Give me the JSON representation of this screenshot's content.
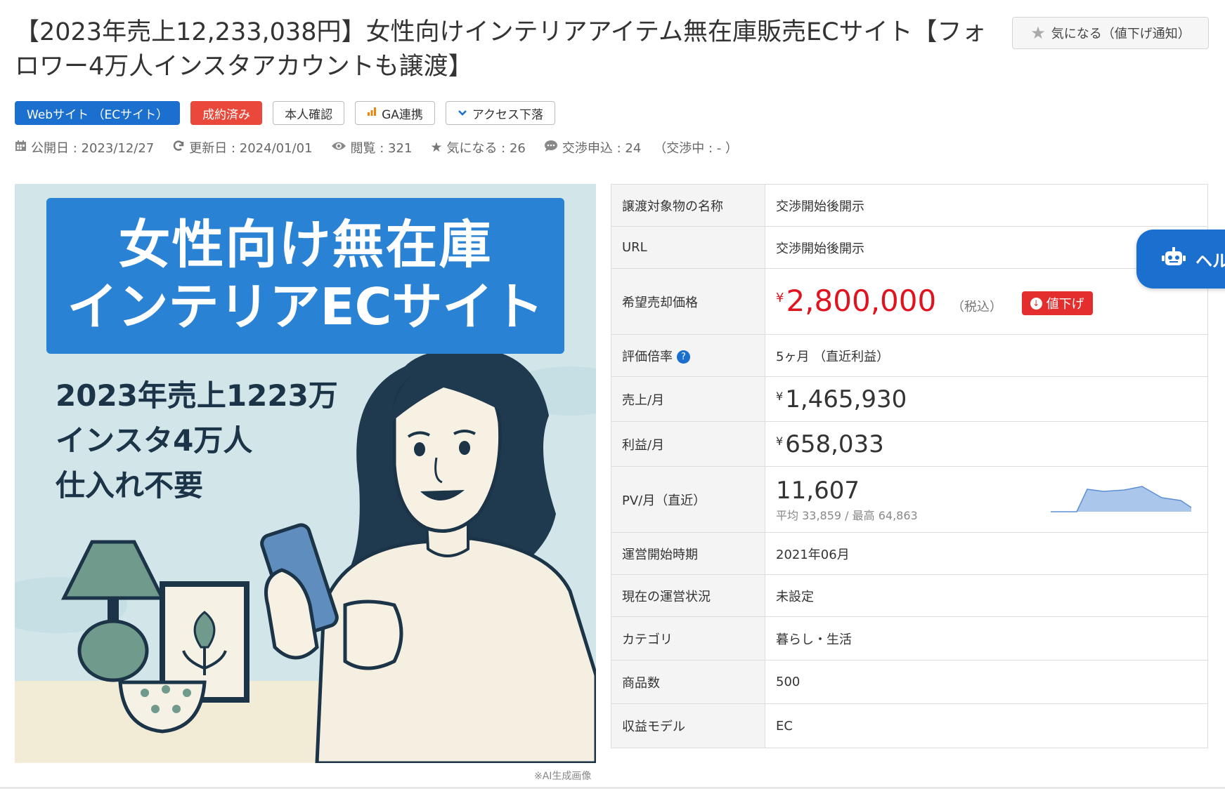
{
  "title": "【2023年売上12,233,038円】女性向けインテリアアイテム無在庫販売ECサイト【フォロワー4万人インスタアカウントも譲渡】",
  "favorite_button": {
    "label": "気になる（値下げ通知）",
    "icon": "star-icon"
  },
  "tags": [
    {
      "label": "Webサイト （ECサイト）",
      "style": "blue"
    },
    {
      "label": "成約済み",
      "style": "red"
    },
    {
      "label": "本人確認",
      "style": "outline"
    },
    {
      "label": "GA連携",
      "style": "outline",
      "icon": "bar-chart-icon"
    },
    {
      "label": "アクセス下落",
      "style": "outline",
      "icon": "chevron-down-icon"
    }
  ],
  "meta": {
    "published": "公開日 : 2023/12/27",
    "updated": "更新日 : 2024/01/01",
    "views": "閲覧 : 321",
    "favorites": "気になる : 26",
    "negotiations": "交渉申込 : 24",
    "in_negotiation": "（交渉中 : - ）"
  },
  "hero": {
    "banner_line1": "女性向け無在庫",
    "banner_line2": "インテリアECサイト",
    "sub_line1": "2023年売上1223万",
    "sub_line2": "インスタ4万人",
    "sub_line3": "仕入れ不要",
    "ai_note": "※AI生成画像"
  },
  "spec": {
    "name_label": "譲渡対象物の名称",
    "name_value": "交渉開始後開示",
    "url_label": "URL",
    "url_value": "交渉開始後開示",
    "price_label": "希望売却価格",
    "price_currency": "¥",
    "price_value": "2,800,000",
    "price_tax": "（税込）",
    "price_badge": "値下げ",
    "multiple_label": "評価倍率",
    "multiple_help": "?",
    "multiple_value": "5ヶ月 （直近利益）",
    "sales_label": "売上/月",
    "sales_currency": "¥",
    "sales_value": "1,465,930",
    "profit_label": "利益/月",
    "profit_currency": "¥",
    "profit_value": "658,033",
    "pv_label": "PV/月（直近）",
    "pv_value": "11,607",
    "pv_sub": "平均 33,859 / 最高 64,863",
    "start_label": "運営開始時期",
    "start_value": "2021年06月",
    "status_label": "現在の運営状況",
    "status_value": "未設定",
    "category_label": "カテゴリ",
    "category_value": "暮らし・生活",
    "items_label": "商品数",
    "items_value": "500",
    "model_label": "収益モデル",
    "model_value": "EC"
  },
  "help_tab": {
    "label": "ヘル",
    "icon": "robot-icon"
  },
  "colors": {
    "accent": "#1a6fcf",
    "price": "#e0141e",
    "badge_red": "#e42e2e",
    "sold": "#e9483b"
  }
}
